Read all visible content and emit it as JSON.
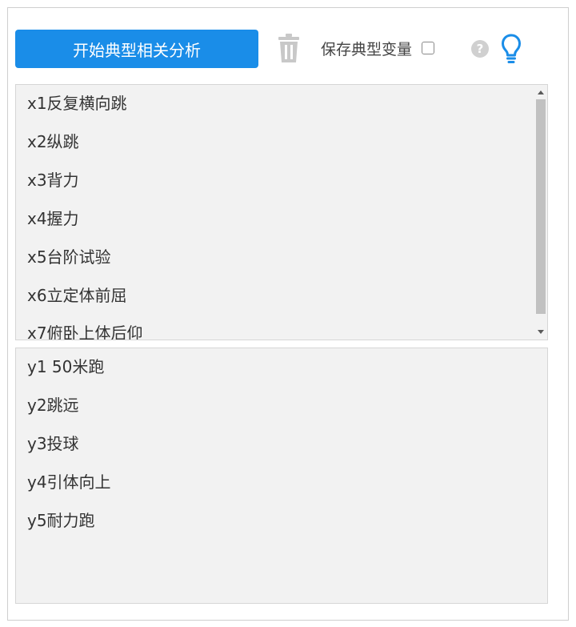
{
  "toolbar": {
    "run_button_label": "开始典型相关分析",
    "save_label": "保存典型变量",
    "help_symbol": "?",
    "save_checked": false
  },
  "icons": {
    "trash": "trash-icon",
    "help": "help-icon",
    "bulb": "lightbulb-icon",
    "trash_color": "#c8c8c8",
    "bulb_color": "#1a8de8"
  },
  "colors": {
    "accent": "#1a8de8",
    "list_background": "#f2f2f2"
  },
  "x_variables": [
    "x1反复横向跳",
    "x2纵跳",
    "x3背力",
    "x4握力",
    "x5台阶试验",
    "x6立定体前屈",
    "x7俯卧上体后仰"
  ],
  "y_variables": [
    "y1 50米跑",
    "y2跳远",
    "y3投球",
    "y4引体向上",
    "y5耐力跑"
  ]
}
